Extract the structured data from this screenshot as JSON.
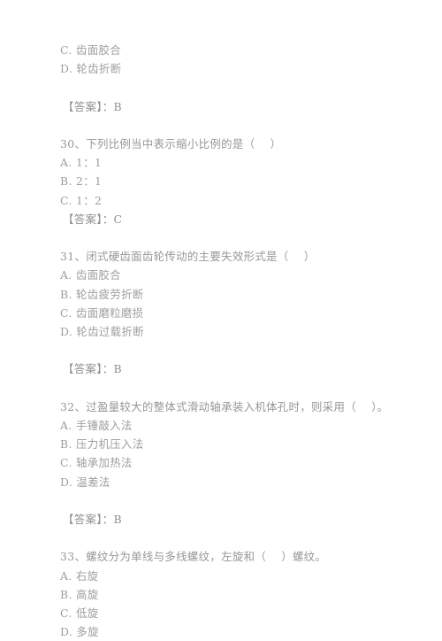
{
  "document": {
    "type": "exam-practice-page",
    "language": "zh-CN",
    "text_color": "#9c9c9c",
    "background_color": "#ffffff",
    "answer_label": "【答案】：",
    "blocks": [
      {
        "id": "q29-tail",
        "kind": "question-tail",
        "options": [
          "C. 齿面胶合",
          "D. 轮齿折断"
        ],
        "answer_line": "【答案】：B"
      },
      {
        "id": "q30",
        "kind": "question",
        "number": "30",
        "stem": "30、下列比例当中表示缩小比例的是（    ）",
        "options": [
          "A. 1：1",
          "B. 2：1",
          "C. 1：2"
        ],
        "answer_line": "【答案】：C"
      },
      {
        "id": "q31",
        "kind": "question",
        "number": "31",
        "stem": "31、闭式硬齿面齿轮传动的主要失效形式是（    ）",
        "options": [
          "A. 齿面胶合",
          "B. 轮齿疲劳折断",
          "C. 齿面磨粒磨损",
          "D. 轮齿过载折断"
        ],
        "answer_line": "【答案】：B"
      },
      {
        "id": "q32",
        "kind": "question",
        "number": "32",
        "stem": "32、过盈量较大的整体式滑动轴承装入机体孔时，则采用（    ）。",
        "options": [
          "A. 手锤敲入法",
          "B. 压力机压入法",
          "C. 轴承加热法",
          "D. 温差法"
        ],
        "answer_line": "【答案】：B"
      },
      {
        "id": "q33",
        "kind": "question",
        "number": "33",
        "stem": "33、螺纹分为单线与多线螺纹，左旋和（    ）螺纹。",
        "options": [
          "A. 右旋",
          "B. 高旋",
          "C. 低旋",
          "D. 多旋"
        ],
        "answer_line": ""
      }
    ]
  }
}
